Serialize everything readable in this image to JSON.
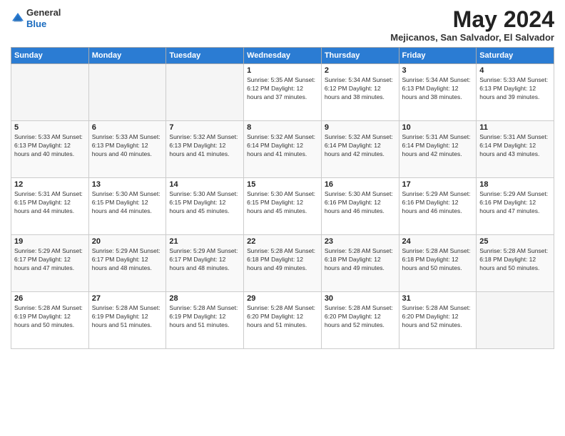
{
  "header": {
    "logo_general": "General",
    "logo_blue": "Blue",
    "month_year": "May 2024",
    "location": "Mejicanos, San Salvador, El Salvador"
  },
  "days_of_week": [
    "Sunday",
    "Monday",
    "Tuesday",
    "Wednesday",
    "Thursday",
    "Friday",
    "Saturday"
  ],
  "weeks": [
    [
      {
        "day": "",
        "info": ""
      },
      {
        "day": "",
        "info": ""
      },
      {
        "day": "",
        "info": ""
      },
      {
        "day": "1",
        "info": "Sunrise: 5:35 AM\nSunset: 6:12 PM\nDaylight: 12 hours\nand 37 minutes."
      },
      {
        "day": "2",
        "info": "Sunrise: 5:34 AM\nSunset: 6:12 PM\nDaylight: 12 hours\nand 38 minutes."
      },
      {
        "day": "3",
        "info": "Sunrise: 5:34 AM\nSunset: 6:13 PM\nDaylight: 12 hours\nand 38 minutes."
      },
      {
        "day": "4",
        "info": "Sunrise: 5:33 AM\nSunset: 6:13 PM\nDaylight: 12 hours\nand 39 minutes."
      }
    ],
    [
      {
        "day": "5",
        "info": "Sunrise: 5:33 AM\nSunset: 6:13 PM\nDaylight: 12 hours\nand 40 minutes."
      },
      {
        "day": "6",
        "info": "Sunrise: 5:33 AM\nSunset: 6:13 PM\nDaylight: 12 hours\nand 40 minutes."
      },
      {
        "day": "7",
        "info": "Sunrise: 5:32 AM\nSunset: 6:13 PM\nDaylight: 12 hours\nand 41 minutes."
      },
      {
        "day": "8",
        "info": "Sunrise: 5:32 AM\nSunset: 6:14 PM\nDaylight: 12 hours\nand 41 minutes."
      },
      {
        "day": "9",
        "info": "Sunrise: 5:32 AM\nSunset: 6:14 PM\nDaylight: 12 hours\nand 42 minutes."
      },
      {
        "day": "10",
        "info": "Sunrise: 5:31 AM\nSunset: 6:14 PM\nDaylight: 12 hours\nand 42 minutes."
      },
      {
        "day": "11",
        "info": "Sunrise: 5:31 AM\nSunset: 6:14 PM\nDaylight: 12 hours\nand 43 minutes."
      }
    ],
    [
      {
        "day": "12",
        "info": "Sunrise: 5:31 AM\nSunset: 6:15 PM\nDaylight: 12 hours\nand 44 minutes."
      },
      {
        "day": "13",
        "info": "Sunrise: 5:30 AM\nSunset: 6:15 PM\nDaylight: 12 hours\nand 44 minutes."
      },
      {
        "day": "14",
        "info": "Sunrise: 5:30 AM\nSunset: 6:15 PM\nDaylight: 12 hours\nand 45 minutes."
      },
      {
        "day": "15",
        "info": "Sunrise: 5:30 AM\nSunset: 6:15 PM\nDaylight: 12 hours\nand 45 minutes."
      },
      {
        "day": "16",
        "info": "Sunrise: 5:30 AM\nSunset: 6:16 PM\nDaylight: 12 hours\nand 46 minutes."
      },
      {
        "day": "17",
        "info": "Sunrise: 5:29 AM\nSunset: 6:16 PM\nDaylight: 12 hours\nand 46 minutes."
      },
      {
        "day": "18",
        "info": "Sunrise: 5:29 AM\nSunset: 6:16 PM\nDaylight: 12 hours\nand 47 minutes."
      }
    ],
    [
      {
        "day": "19",
        "info": "Sunrise: 5:29 AM\nSunset: 6:17 PM\nDaylight: 12 hours\nand 47 minutes."
      },
      {
        "day": "20",
        "info": "Sunrise: 5:29 AM\nSunset: 6:17 PM\nDaylight: 12 hours\nand 48 minutes."
      },
      {
        "day": "21",
        "info": "Sunrise: 5:29 AM\nSunset: 6:17 PM\nDaylight: 12 hours\nand 48 minutes."
      },
      {
        "day": "22",
        "info": "Sunrise: 5:28 AM\nSunset: 6:18 PM\nDaylight: 12 hours\nand 49 minutes."
      },
      {
        "day": "23",
        "info": "Sunrise: 5:28 AM\nSunset: 6:18 PM\nDaylight: 12 hours\nand 49 minutes."
      },
      {
        "day": "24",
        "info": "Sunrise: 5:28 AM\nSunset: 6:18 PM\nDaylight: 12 hours\nand 50 minutes."
      },
      {
        "day": "25",
        "info": "Sunrise: 5:28 AM\nSunset: 6:18 PM\nDaylight: 12 hours\nand 50 minutes."
      }
    ],
    [
      {
        "day": "26",
        "info": "Sunrise: 5:28 AM\nSunset: 6:19 PM\nDaylight: 12 hours\nand 50 minutes."
      },
      {
        "day": "27",
        "info": "Sunrise: 5:28 AM\nSunset: 6:19 PM\nDaylight: 12 hours\nand 51 minutes."
      },
      {
        "day": "28",
        "info": "Sunrise: 5:28 AM\nSunset: 6:19 PM\nDaylight: 12 hours\nand 51 minutes."
      },
      {
        "day": "29",
        "info": "Sunrise: 5:28 AM\nSunset: 6:20 PM\nDaylight: 12 hours\nand 51 minutes."
      },
      {
        "day": "30",
        "info": "Sunrise: 5:28 AM\nSunset: 6:20 PM\nDaylight: 12 hours\nand 52 minutes."
      },
      {
        "day": "31",
        "info": "Sunrise: 5:28 AM\nSunset: 6:20 PM\nDaylight: 12 hours\nand 52 minutes."
      },
      {
        "day": "",
        "info": ""
      }
    ]
  ]
}
